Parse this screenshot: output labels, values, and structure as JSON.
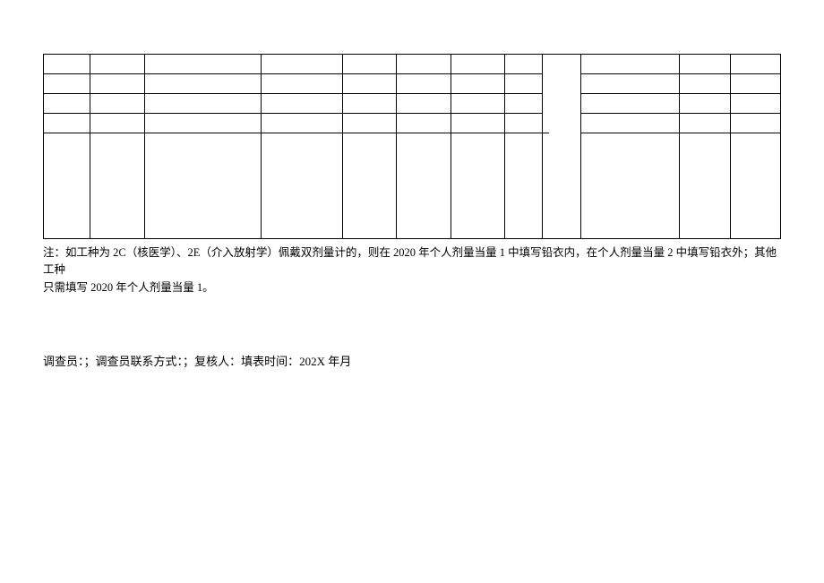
{
  "note": {
    "line1": "注：如工种为 2C（核医学）、2E（介入放射学）佩戴双剂量计的，则在 2020 年个人剂量当量 1 中填写铅衣内，在个人剂量当量 2 中填写铅衣外；其他工种",
    "line2": "只需填写 2020 年个人剂量当量 1。"
  },
  "footer": {
    "investigator_label": "调查员：",
    "sep1": "；",
    "contact_label": "调查员联系方式：",
    "sep2": "；",
    "reviewer_label": "复核人：",
    "filltime_label": "填表时间：",
    "filltime_value": "202X 年月"
  }
}
